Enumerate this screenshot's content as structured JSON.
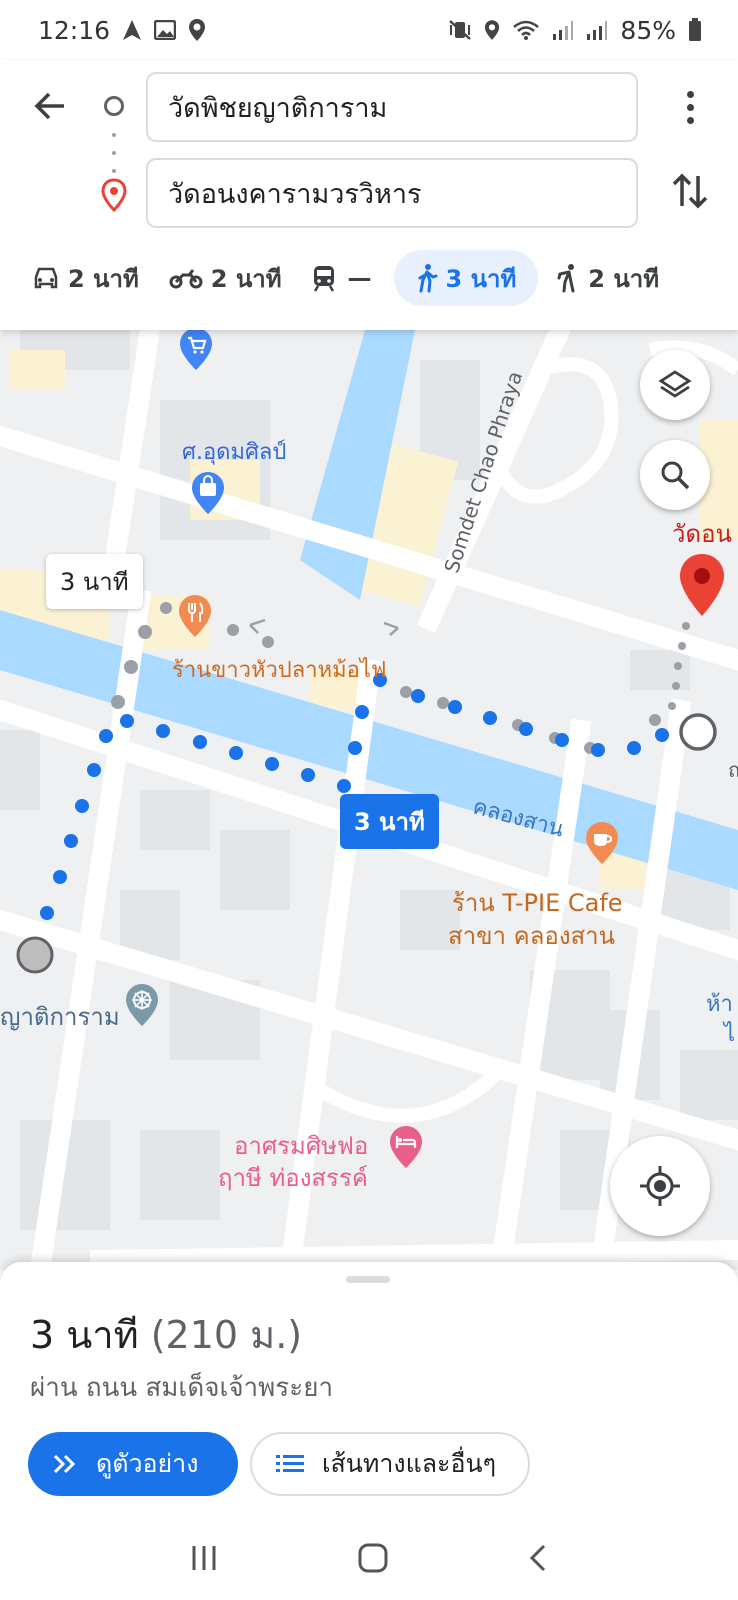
{
  "status_bar": {
    "time": "12:16",
    "battery": "85%"
  },
  "directions": {
    "from": "วัดพิชยญาติการาม",
    "to": "วัดอนงคารามวรวิหาร"
  },
  "modes": [
    {
      "name": "car",
      "value": "2 นาที"
    },
    {
      "name": "motorcycle",
      "value": "2 นาที"
    },
    {
      "name": "transit",
      "value": "—"
    },
    {
      "name": "walk",
      "value": "3 นาที",
      "active": true
    },
    {
      "name": "ride",
      "value": "2 นาที"
    }
  ],
  "map": {
    "labels": {
      "road_somdet": "Somdet Chao Phraya",
      "shop_udom": "ศ.อุดมศิลป์",
      "restaurant": "ร้านขาวหัวปลาหม้อไฟ",
      "canal": "คลองสาน",
      "cafe_line1": "ร้าน T-PIE Cafe",
      "cafe_line2": "สาขา คลองสาน",
      "temple_origin": "ญาติการาม",
      "dest_partial": "วัดอน",
      "hotel_line1": "อาศรมศิษฟอ",
      "hotel_line2": "ฤาษี ท่องสรรค์",
      "right_edge_1": "ห้า",
      "right_edge_2": "ไ",
      "right_edge_3": "ถ"
    },
    "bubbles": {
      "alt_time": "3 นาที",
      "main_time": "3 นาที"
    },
    "colors": {
      "route": "#1a73e8",
      "dest_pin": "#ea4335",
      "water": "#aadaff"
    }
  },
  "sheet": {
    "duration": "3 นาที",
    "distance": "(210 ม.)",
    "via": "ผ่าน ถนน สมเด็จเจ้าพระยา",
    "preview_button": "ดูตัวอย่าง",
    "steps_button": "เส้นทางและอื่นๆ"
  }
}
